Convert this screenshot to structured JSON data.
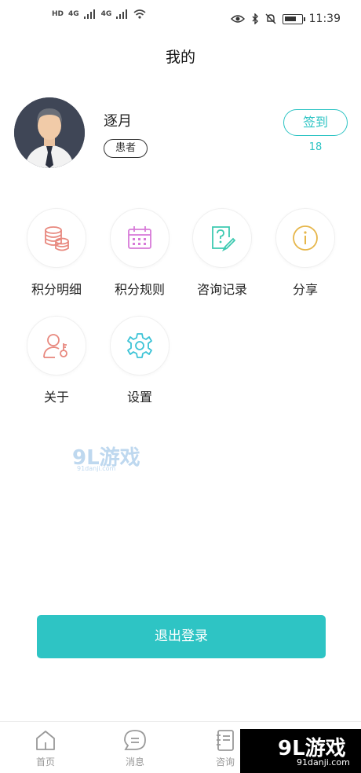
{
  "status_bar": {
    "left_indicators": [
      "HD",
      "4G",
      "4G"
    ],
    "time": "11:39"
  },
  "header": {
    "title": "我的"
  },
  "profile": {
    "username": "逐月",
    "role": "患者",
    "signin_label": "签到",
    "signin_count": "18"
  },
  "menu": [
    {
      "label": "积分明细",
      "icon": "coins-stack-icon",
      "color": "#e8897f"
    },
    {
      "label": "积分规则",
      "icon": "calendar-icon",
      "color": "#d77ad8"
    },
    {
      "label": "咨询记录",
      "icon": "question-doc-icon",
      "color": "#3cc9b0"
    },
    {
      "label": "分享",
      "icon": "info-circle-icon",
      "color": "#e6b64a"
    },
    {
      "label": "关于",
      "icon": "user-key-icon",
      "color": "#e8897f"
    },
    {
      "label": "设置",
      "icon": "gear-icon",
      "color": "#3cc3d6"
    }
  ],
  "logout_label": "退出登录",
  "tabs": [
    {
      "label": "首页",
      "icon": "home-icon"
    },
    {
      "label": "消息",
      "icon": "chat-icon"
    },
    {
      "label": "咨询",
      "icon": "notebook-icon"
    }
  ],
  "watermark": {
    "logo": "9L游戏",
    "url": "91danji.com"
  },
  "colors": {
    "accent": "#2ec4c4"
  }
}
